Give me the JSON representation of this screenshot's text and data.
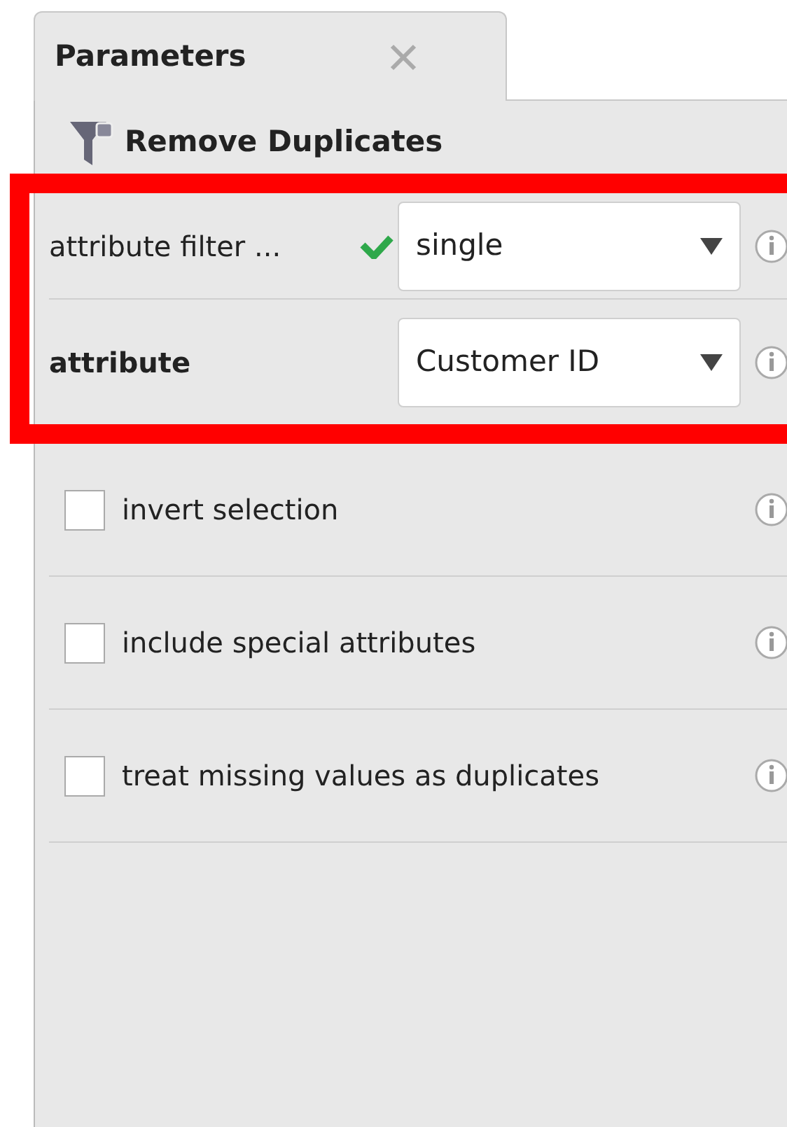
{
  "tabs": [
    {
      "label": "Parameters",
      "selected": true,
      "closable": true
    }
  ],
  "operator": {
    "name": "Remove Duplicates"
  },
  "parameters": [
    {
      "kind": "dropdown",
      "label": "attribute filter ...",
      "required": false,
      "valid": true,
      "value": "single",
      "highlighted": true
    },
    {
      "kind": "dropdown",
      "label": "attribute",
      "required": true,
      "valid": false,
      "value": "Customer ID",
      "highlighted": true
    },
    {
      "kind": "checkbox",
      "label": "invert selection",
      "checked": false,
      "highlighted": false
    },
    {
      "kind": "checkbox",
      "label": "include special attributes",
      "checked": false,
      "highlighted": false
    },
    {
      "kind": "checkbox",
      "label": "treat missing values as duplicates",
      "checked": false,
      "highlighted": false
    }
  ]
}
